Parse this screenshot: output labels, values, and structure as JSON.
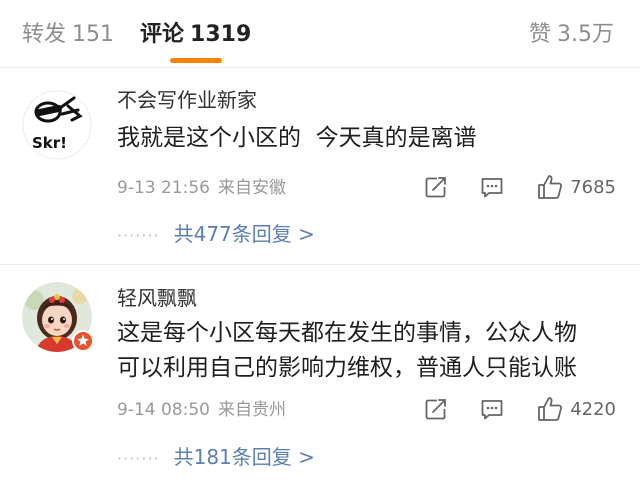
{
  "tabs": {
    "repost": {
      "label": "转发",
      "count": "151"
    },
    "comments": {
      "label": "评论",
      "count": "1319"
    },
    "likes": {
      "label": "赞",
      "count": "3.5万"
    }
  },
  "colors": {
    "accent": "#ff8200",
    "link": "#5b7fb6",
    "badge": "#e8532c"
  },
  "comments": [
    {
      "username": "不会写作业新家",
      "text": "我就是这个小区的  今天真的是离谱",
      "time": "9-13 21:56",
      "location": "来自安徽",
      "likes": "7685",
      "dots": "·······",
      "replies_label": "共477条回复 >",
      "avatar_text": "Skr!",
      "icons": [
        "share-icon",
        "comment-icon",
        "like-icon"
      ]
    },
    {
      "username": "轻风飘飘",
      "text_lines": [
        "这是每个小区每天都在发生的事情，公众人物",
        "可以利用自己的影响力维权，普通人只能认账"
      ],
      "time": "9-14 08:50",
      "location": "来自贵州",
      "likes": "4220",
      "dots": "·······",
      "replies_label": "共181条回复 >",
      "icons": [
        "share-icon",
        "comment-icon",
        "like-icon"
      ]
    }
  ]
}
